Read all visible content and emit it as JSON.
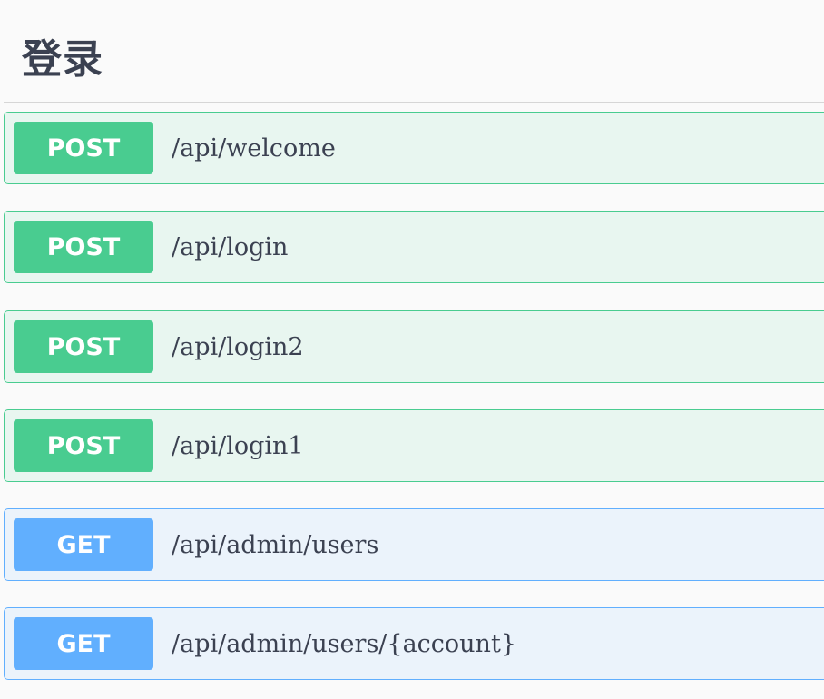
{
  "section": {
    "title": "登录"
  },
  "operations": [
    {
      "method": "POST",
      "path": "/api/welcome"
    },
    {
      "method": "POST",
      "path": "/api/login"
    },
    {
      "method": "POST",
      "path": "/api/login2"
    },
    {
      "method": "POST",
      "path": "/api/login1"
    },
    {
      "method": "GET",
      "path": "/api/admin/users"
    },
    {
      "method": "GET",
      "path": "/api/admin/users/{account}"
    }
  ],
  "colors": {
    "post": "#49cc90",
    "post_bg": "#e8f6f0",
    "get": "#61affe",
    "get_bg": "#ebf3fb",
    "text": "#3b4151"
  }
}
